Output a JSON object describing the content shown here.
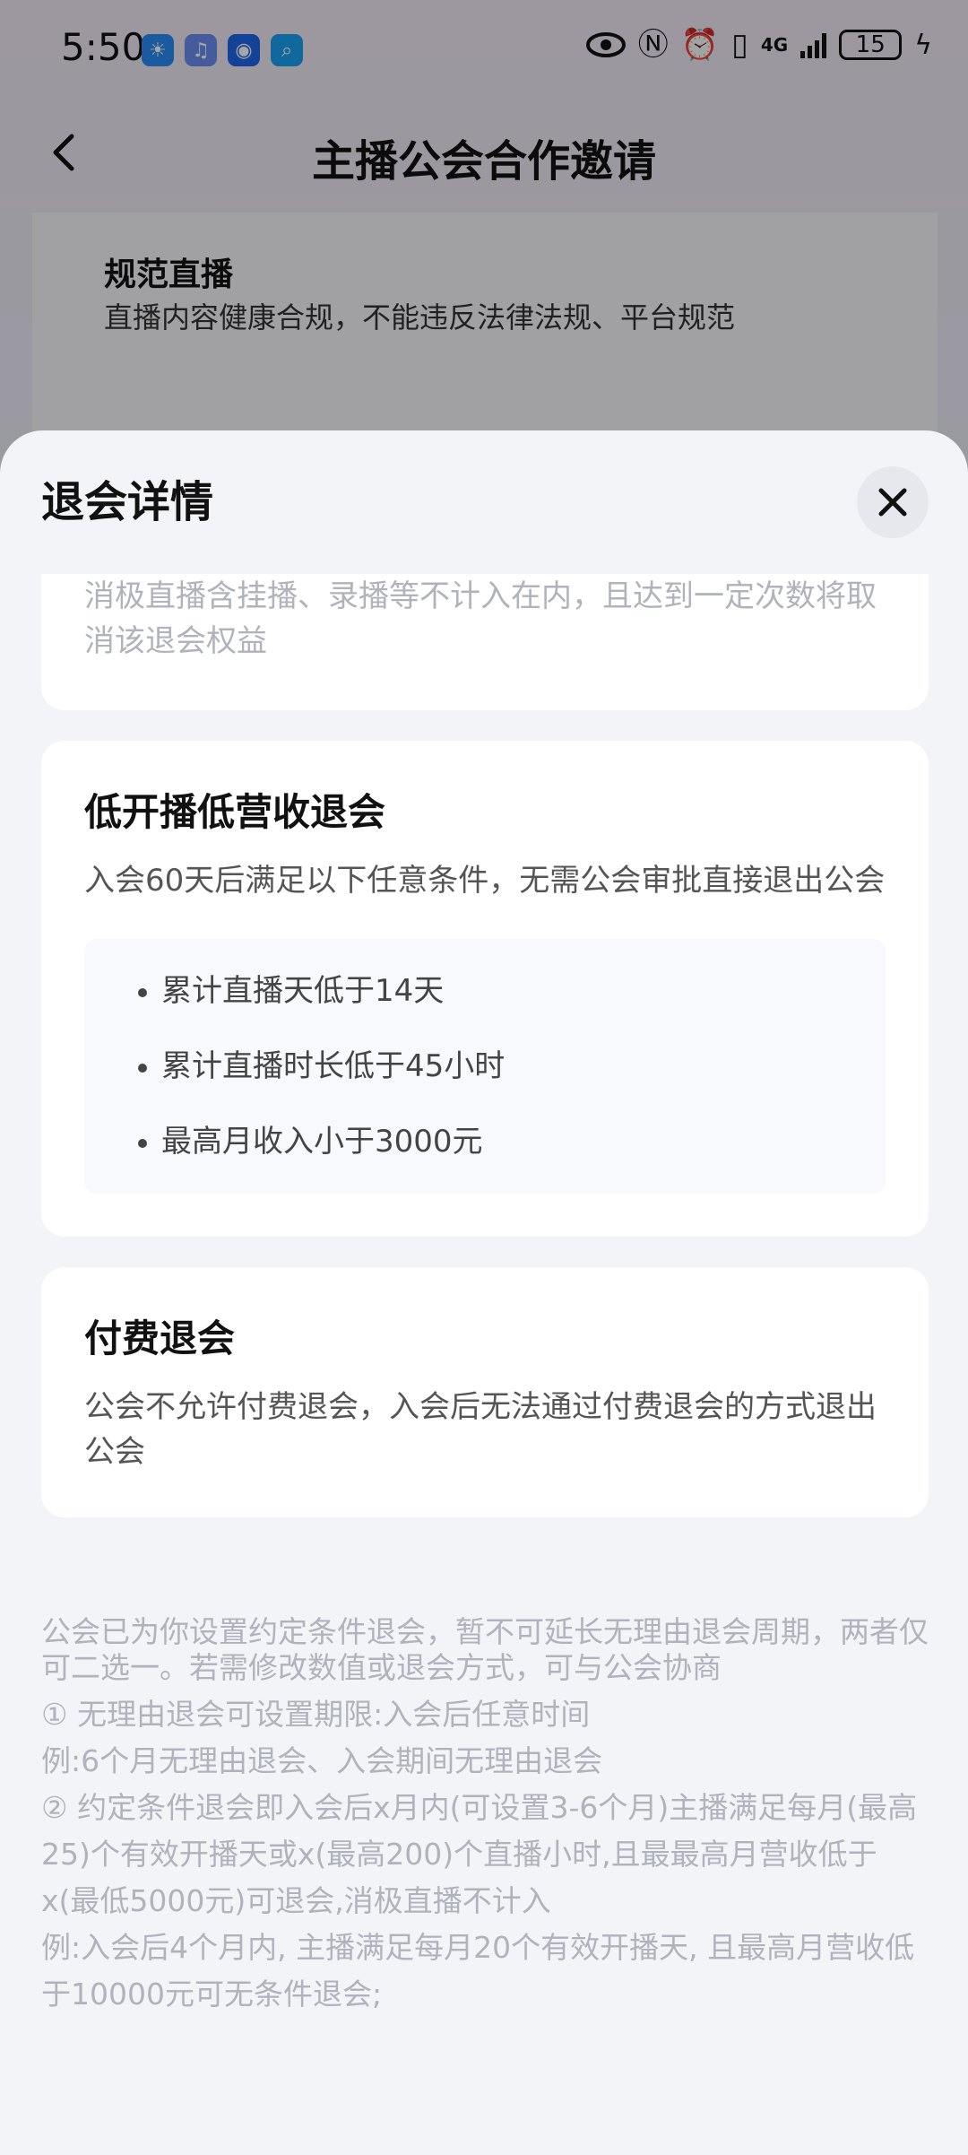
{
  "status_bar": {
    "time": "5:50",
    "battery": "15",
    "network": "4G"
  },
  "background_page": {
    "title": "主播公会合作邀请",
    "card_title": "规范直播",
    "card_desc": "直播内容健康合规，不能违反法律法规、平台规范"
  },
  "sheet": {
    "title": "退会详情",
    "partial_card_text": "消极直播含挂播、录播等不计入在内，且达到一定次数将取消该退会权益",
    "low_card": {
      "title": "低开播低营收退会",
      "desc": "入会60天后满足以下任意条件，无需公会审批直接退出公会",
      "conditions": [
        "累计直播天低于14天",
        "累计直播时长低于45小时",
        "最高月收入小于3000元"
      ]
    },
    "paid_card": {
      "title": "付费退会",
      "desc": "公会不允许付费退会，入会后无法通过付费退会的方式退出公会"
    },
    "notes": [
      "公会已为你设置约定条件退会，暂不可延长无理由退会周期，两者仅可二选一。若需修改数值或退会方式，可与公会协商",
      "① 无理由退会可设置期限:入会后任意时间",
      "例:6个月无理由退会、入会期间无理由退会",
      "② 约定条件退会即入会后x月内(可设置3-6个月)主播满足每月(最高25)个有效开播天或x(最高200)个直播小时,且最最高月营收低于x(最低5000元)可退会,消极直播不计入",
      "例:入会后4个月内, 主播满足每月20个有效开播天, 且最高月营收低于10000元可无条件退会;"
    ]
  },
  "colors": {
    "sheet_bg": "#f3f4f8",
    "card_bg": "#ffffff",
    "muted_text": "#b0b3bc"
  }
}
